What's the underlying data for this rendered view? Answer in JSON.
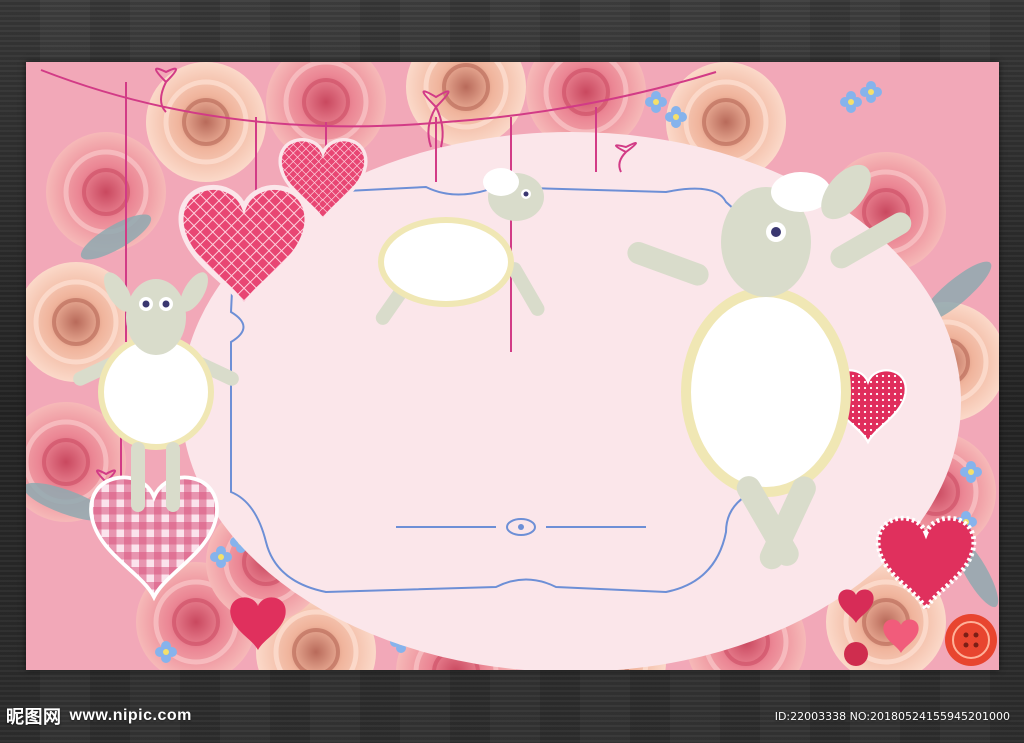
{
  "footer": {
    "brand": "昵图网",
    "url": "www.nipic.com",
    "image_id": "ID:22003338 NO:20180524155945201000"
  },
  "colors": {
    "background_board": "#f2a8b8",
    "frame_fill": "#fbe6ea",
    "frame_line": "#6d8fd6",
    "string": "#d23b86",
    "heart_red": "#e0305d",
    "sheep_wool": "#ffffff",
    "sheep_body": "#d9dccb"
  },
  "icons": [
    "flower-icon",
    "heart-icon",
    "sheep-icon",
    "bow-icon",
    "button-icon"
  ]
}
